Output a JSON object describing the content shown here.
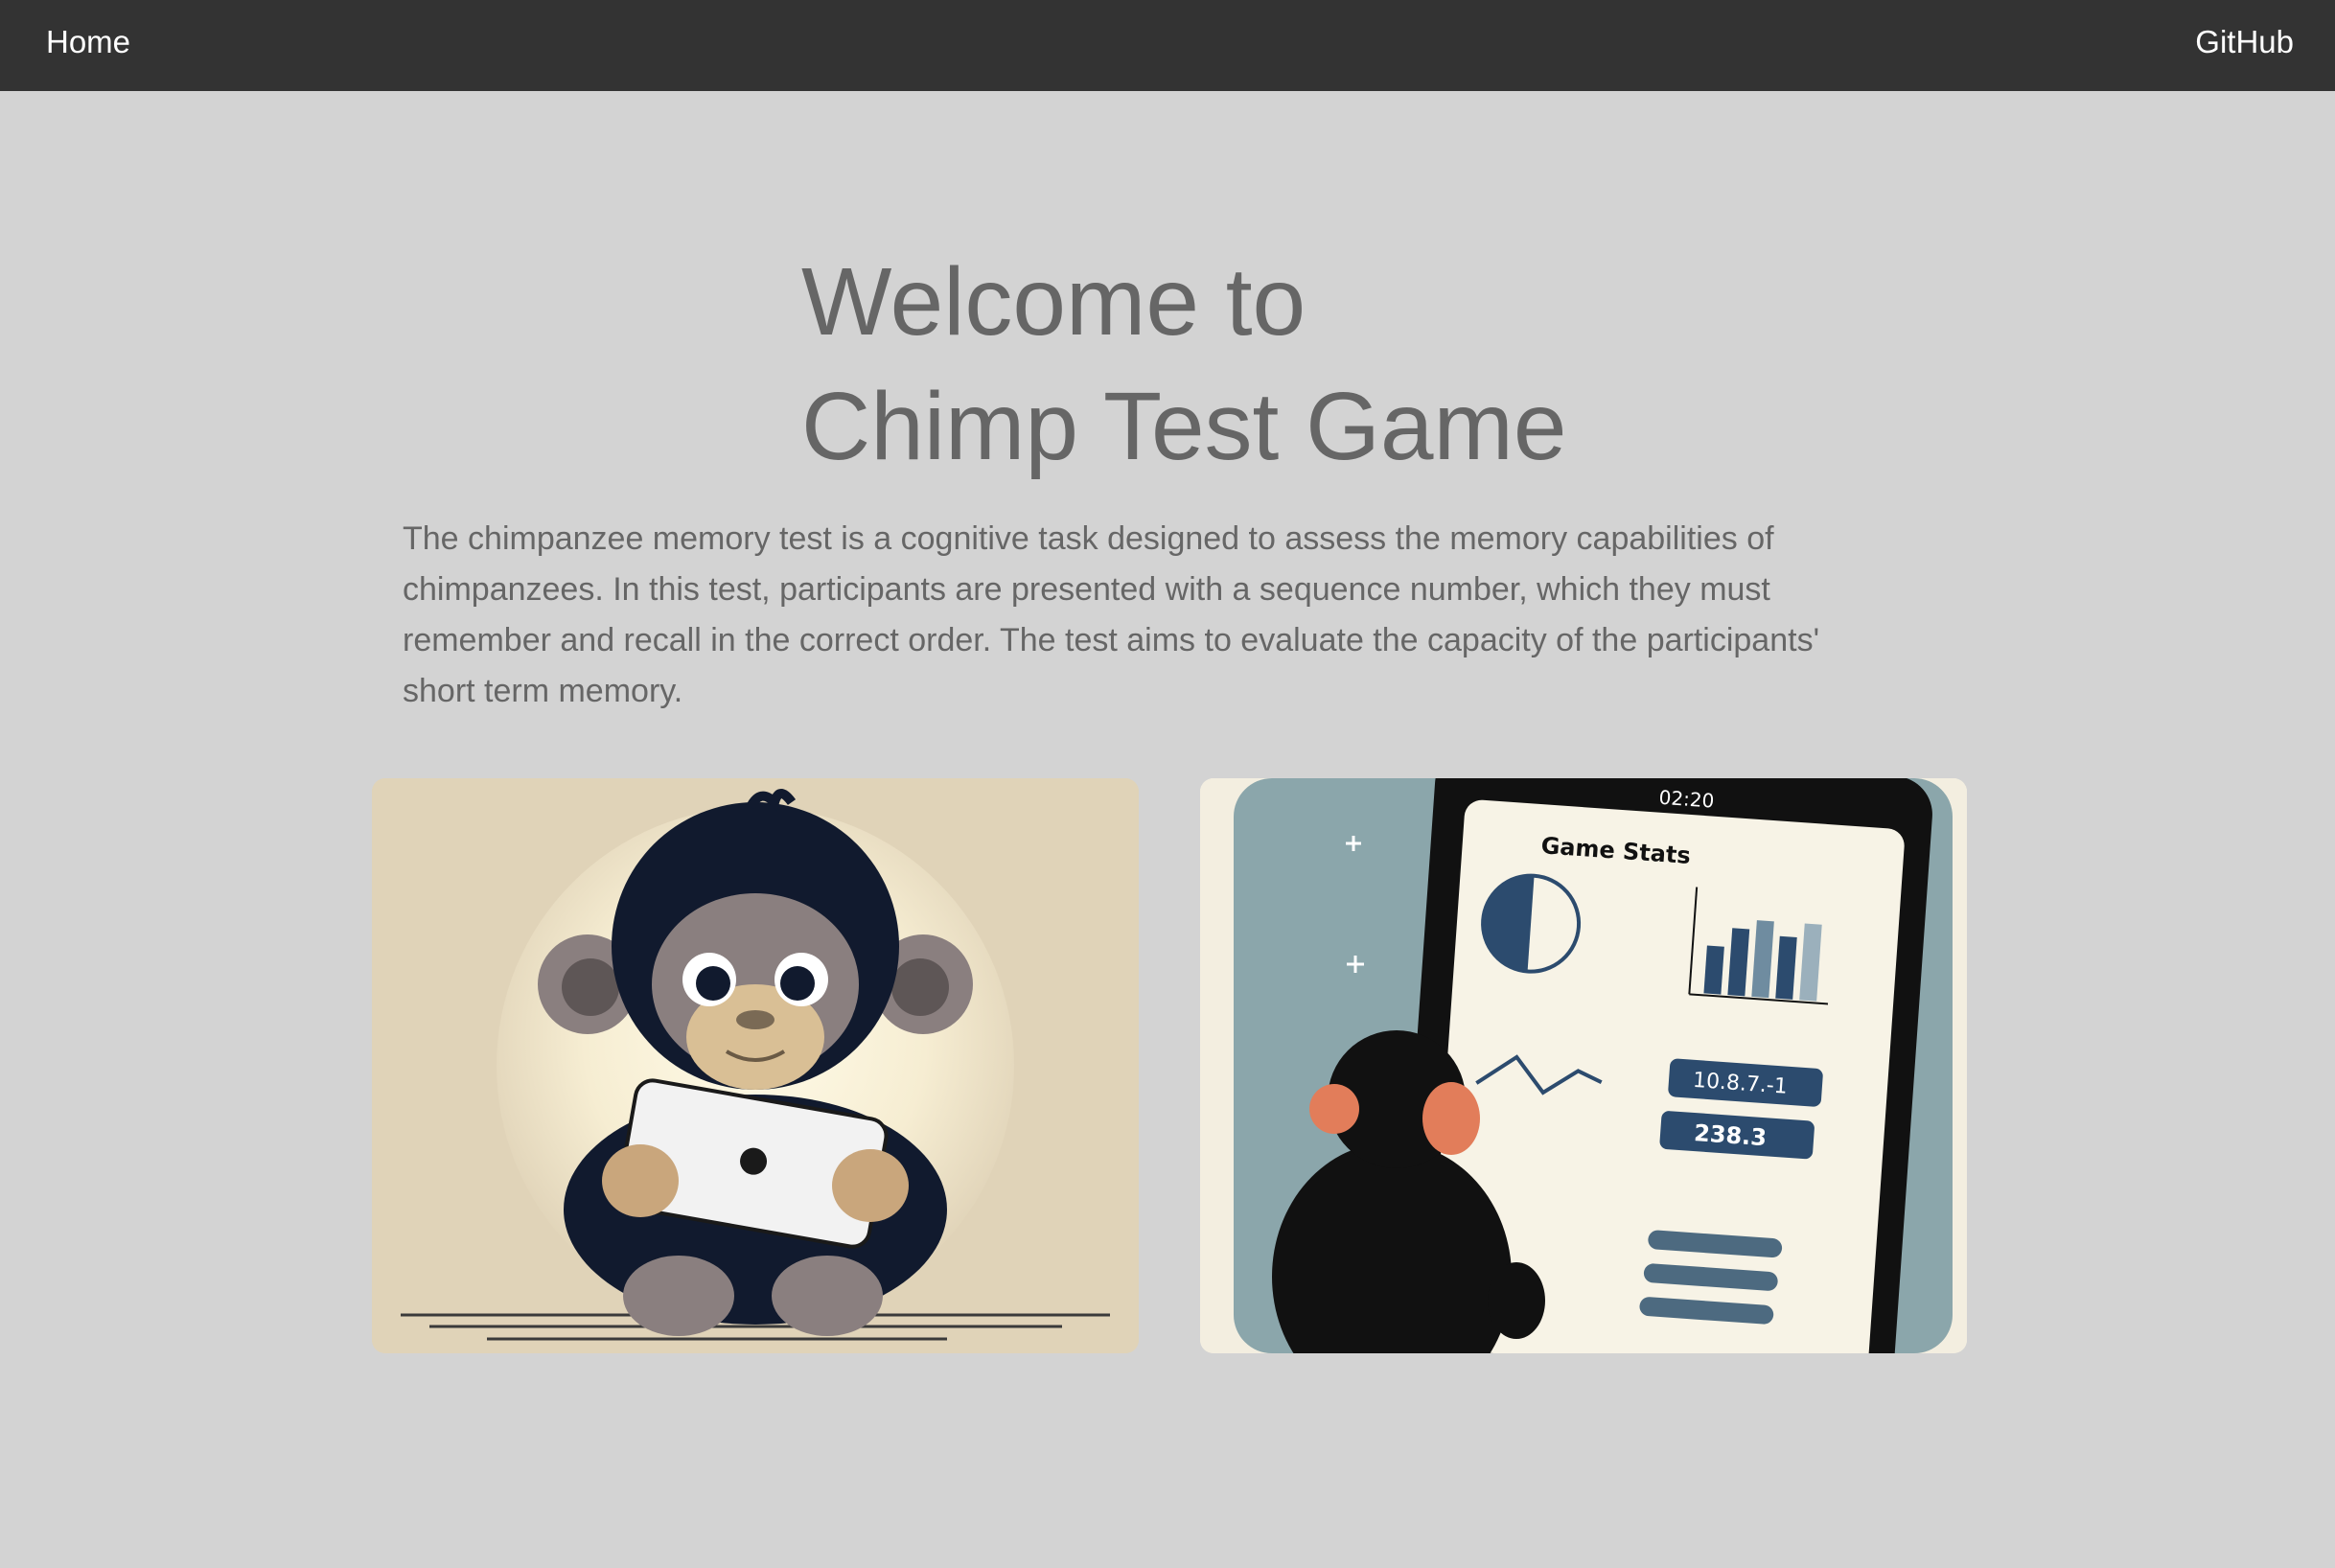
{
  "nav": {
    "home_label": "Home",
    "github_label": "GitHub"
  },
  "hero": {
    "title_line1": "Welcome to",
    "title_line2": "Chimp Test Game",
    "description": "The chimpanzee memory test is a cognitive task designed to assess the memory capabilities of chimpanzees. In this test, participants are presented with a sequence number, which they must remember and recall in the correct order. The test aims to evaluate the capacity of the participants' short term memory."
  },
  "images": {
    "left": {
      "icon": "chimp-with-tablet-illustration"
    },
    "right": {
      "icon": "chimp-viewing-game-stats-illustration",
      "tablet_time": "02:20",
      "panel_title": "Game Stats",
      "stat_a": "10.8.7.-1",
      "stat_b": "238.3"
    }
  },
  "colors": {
    "navbar": "#333333",
    "background": "#d3d3d3",
    "text": "#666666",
    "nav_text": "#ffffff"
  }
}
